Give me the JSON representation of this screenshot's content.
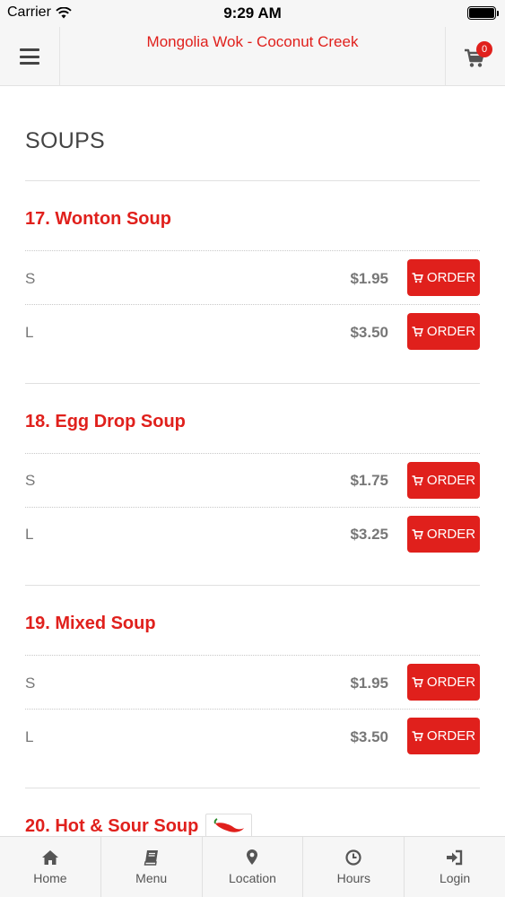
{
  "status_bar": {
    "carrier": "Carrier",
    "time": "9:29 AM"
  },
  "header": {
    "title": "Mongolia Wok - Coconut Creek",
    "cart_count": "0"
  },
  "section": {
    "title": "SOUPS"
  },
  "items": [
    {
      "name": "17. Wonton Soup",
      "prices": [
        {
          "size": "S",
          "price": "$1.95"
        },
        {
          "size": "L",
          "price": "$3.50"
        }
      ]
    },
    {
      "name": "18. Egg Drop Soup",
      "prices": [
        {
          "size": "S",
          "price": "$1.75"
        },
        {
          "size": "L",
          "price": "$3.25"
        }
      ]
    },
    {
      "name": "19. Mixed Soup",
      "prices": [
        {
          "size": "S",
          "price": "$1.95"
        },
        {
          "size": "L",
          "price": "$3.50"
        }
      ]
    },
    {
      "name": "20. Hot & Sour Soup",
      "spicy": true
    }
  ],
  "order_label": "ORDER",
  "bottom_nav": {
    "home": "Home",
    "menu": "Menu",
    "location": "Location",
    "hours": "Hours",
    "login": "Login"
  },
  "colors": {
    "accent": "#e0201c",
    "header_bg": "#f6f6f6"
  },
  "icons": [
    "wifi-icon",
    "battery-icon",
    "hamburger-icon",
    "cart-icon",
    "home-icon",
    "book-icon",
    "map-pin-icon",
    "clock-icon",
    "login-icon",
    "chili-pepper-icon"
  ]
}
